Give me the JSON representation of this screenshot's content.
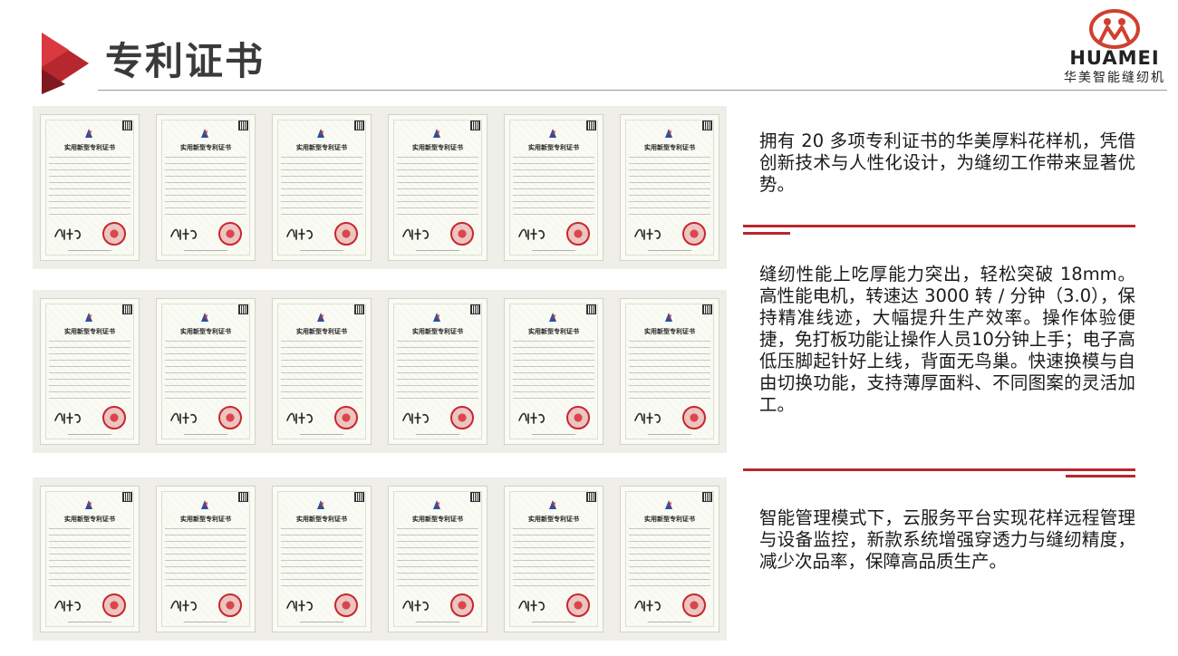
{
  "header": {
    "title": "专利证书",
    "logo_en": "HUAMEI",
    "logo_cn": "华美智能缝纫机"
  },
  "colors": {
    "accent_red": "#b7282e",
    "title_gray": "#3a3a3a",
    "seal_red": "#c8262c"
  },
  "certificates": {
    "title": "实用新型专利证书",
    "rows": 3,
    "per_row": 6
  },
  "paragraphs": [
    "拥有 20 多项专利证书的华美厚料花样机，凭借创新技术与人性化设计，为缝纫工作带来显著优势。",
    "缝纫性能上吃厚能力突出，轻松突破 18mm。高性能电机，转速达 3000 转 / 分钟（3.0），保持精准线迹，大幅提升生产效率。操作体验便捷，免打板功能让操作人员10分钟上手；电子高低压脚起针好上线，背面无鸟巢。快速换模与自由切换功能，支持薄厚面料、不同图案的灵活加工。",
    "智能管理模式下，云服务平台实现花样远程管理与设备监控，新款系统增强穿透力与缝纫精度，减少次品率，保障高品质生产。"
  ]
}
